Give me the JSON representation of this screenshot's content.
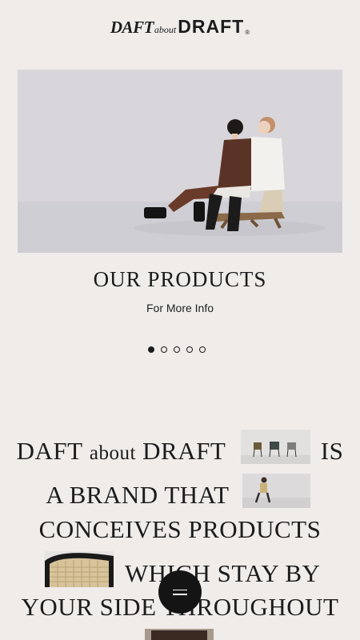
{
  "header": {
    "logo": {
      "daft": "DAFT",
      "about": "about",
      "draft": "DRAFT",
      "reg": "®"
    }
  },
  "hero": {
    "slide_title": "OUR PRODUCTS",
    "slide_link": "For More Info",
    "dots": {
      "count": 5,
      "active_index": 0
    }
  },
  "statement": {
    "line1": {
      "part1": "DAFT",
      "part2": "about",
      "part3": "DRAFT",
      "part4": "IS"
    },
    "line2": "A BRAND THAT",
    "line3": "CONCEIVES PRODUCTS",
    "line4": "WHICH STAY BY",
    "line5": "YOUR SIDE THROUGHOUT"
  },
  "menu_button": {
    "icon": "hamburger-icon"
  },
  "colors": {
    "background": "#efecea",
    "text": "#1c1c1c",
    "menu_button": "#141414"
  }
}
